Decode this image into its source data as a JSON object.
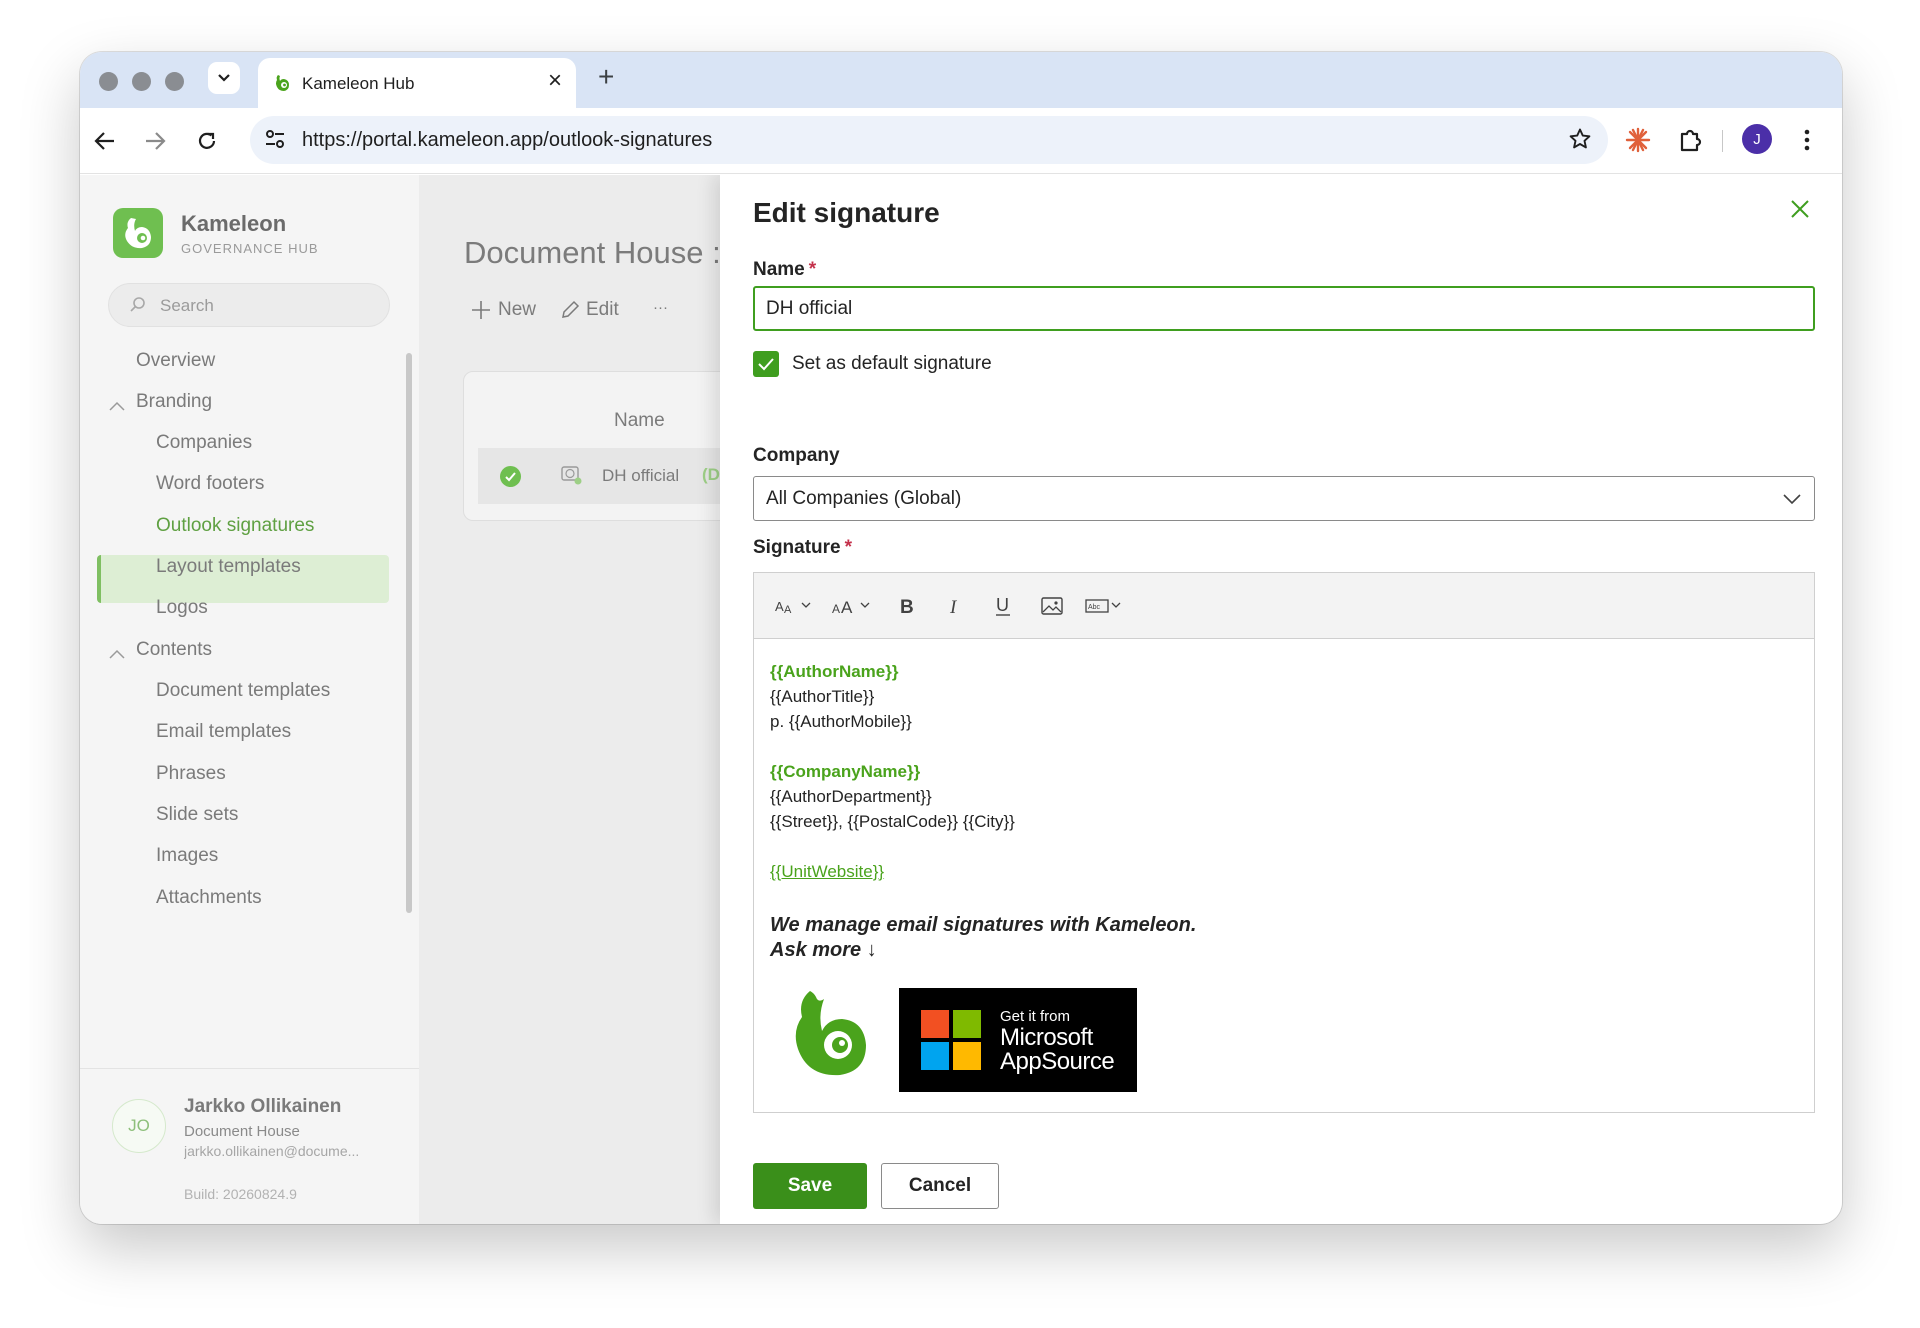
{
  "browser": {
    "tab_title": "Kameleon Hub",
    "tab_close": "×",
    "new_tab": "+",
    "url": "https://portal.kameleon.app/outlook-signatures",
    "profile_initial": "J",
    "accent": "#d9e4f5"
  },
  "sidebar": {
    "brand_name": "Kameleon",
    "brand_sub": "GOVERNANCE HUB",
    "search_placeholder": "Search",
    "items": {
      "overview": "Overview",
      "branding": "Branding",
      "companies": "Companies",
      "word_footers": "Word footers",
      "outlook_signatures": "Outlook signatures",
      "layout_templates": "Layout templates",
      "logos": "Logos",
      "contents": "Contents",
      "document_templates": "Document templates",
      "email_templates": "Email templates",
      "phrases": "Phrases",
      "slide_sets": "Slide sets",
      "images": "Images",
      "attachments": "Attachments"
    },
    "active_item": "Outlook signatures",
    "user": {
      "initials": "JO",
      "name": "Jarkko Ollikainen",
      "org": "Document House",
      "email": "jarkko.ollikainen@docume...",
      "build": "Build: 20260824.9"
    }
  },
  "main": {
    "title": "Document House",
    "title_suffix": ":",
    "new_label": "New",
    "edit_label": "Edit",
    "more_label": "···",
    "table_header": "Name",
    "row_name": "DH official",
    "row_tag": "(D"
  },
  "panel": {
    "title": "Edit signature",
    "name_label": "Name",
    "required_mark": "*",
    "name_value": "DH official",
    "default_label": "Set as default signature",
    "default_checked": true,
    "company_label": "Company",
    "company_value": "All Companies (Global)",
    "signature_label": "Signature",
    "signature": {
      "author_name": "{{AuthorName}}",
      "author_title": "{{AuthorTitle}}",
      "author_mobile": "p. {{AuthorMobile}}",
      "company_name": "{{CompanyName}}",
      "department": "{{AuthorDepartment}}",
      "address": "{{Street}}, {{PostalCode}} {{City}}",
      "website": "{{UnitWebsite}}",
      "tagline_1": "We manage email signatures with Kameleon.",
      "tagline_2": "Ask more ↓",
      "badge_small": "Get it from",
      "badge_line1": "Microsoft",
      "badge_line2": "AppSource"
    },
    "save_label": "Save",
    "cancel_label": "Cancel",
    "accent": "#3f9e1f"
  }
}
